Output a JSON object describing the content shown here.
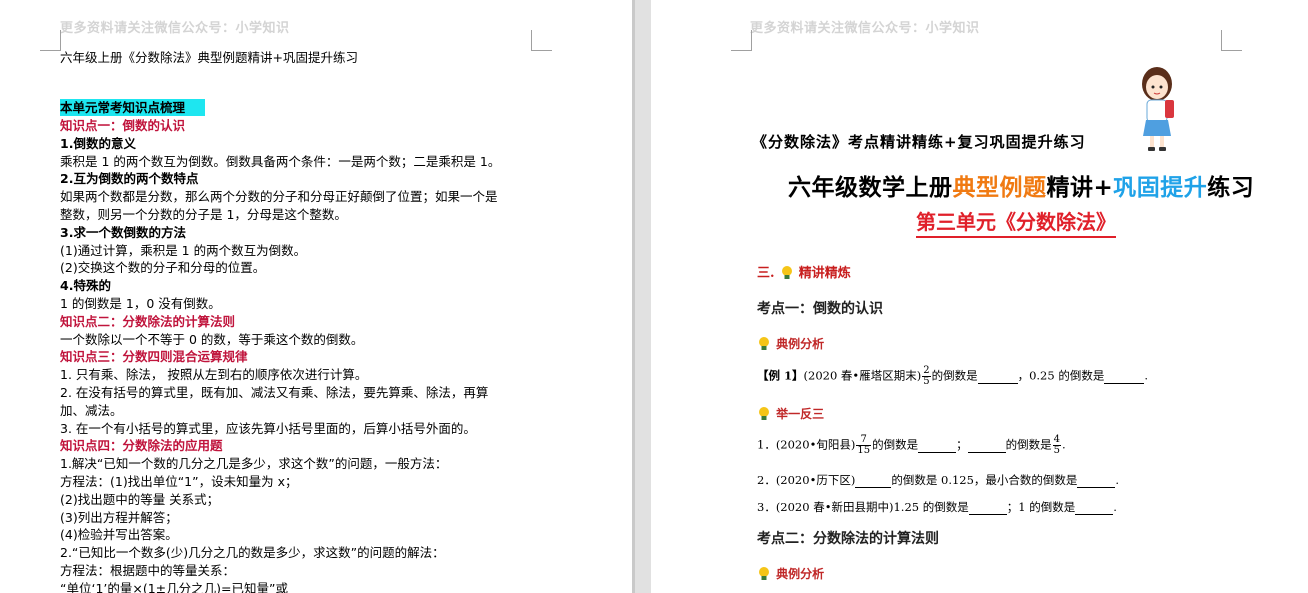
{
  "header": {
    "watermark": "更多资料请关注微信公众号：小学知识"
  },
  "left_page": {
    "doc_title": "六年级上册《分数除法》典型例题精讲+巩固提升练习",
    "section_title": "本单元常考知识点梳理",
    "lines": [
      {
        "text": "知识点一：倒数的认识",
        "style": "red"
      },
      {
        "text": "1.倒数的意义",
        "style": "bold"
      },
      {
        "text": "乘积是 1 的两个数互为倒数。倒数具备两个条件：一是两个数；二是乘积是 1。",
        "style": "normal"
      },
      {
        "text": "2.互为倒数的两个数特点",
        "style": "bold"
      },
      {
        "text": "如果两个数都是分数，那么两个分数的分子和分母正好颠倒了位置；如果一个是",
        "style": "normal"
      },
      {
        "text": "整数，则另一个分数的分子是 1，分母是这个整数。",
        "style": "normal"
      },
      {
        "text": "3.求一个数倒数的方法",
        "style": "bold"
      },
      {
        "text": "(1)通过计算，乘积是 1 的两个数互为倒数。",
        "style": "normal"
      },
      {
        "text": "(2)交换这个数的分子和分母的位置。",
        "style": "normal"
      },
      {
        "text": "4.特殊的",
        "style": "bold"
      },
      {
        "text": "1 的倒数是 1，0 没有倒数。",
        "style": "normal"
      },
      {
        "text": "知识点二：分数除法的计算法则",
        "style": "red"
      },
      {
        "text": "一个数除以一个不等于 0 的数，等于乘这个数的倒数。",
        "style": "normal"
      },
      {
        "text": "知识点三：分数四则混合运算规律",
        "style": "red"
      },
      {
        "text": "1. 只有乘、除法， 按照从左到右的顺序依次进行计算。",
        "style": "normal"
      },
      {
        "text": "2. 在没有括号的算式里，既有加、减法又有乘、除法，要先算乘、除法，再算",
        "style": "normal"
      },
      {
        "text": "加、减法。",
        "style": "normal"
      },
      {
        "text": "3. 在一个有小括号的算式里，应该先算小括号里面的，后算小括号外面的。",
        "style": "normal"
      },
      {
        "text": "知识点四：分数除法的应用题",
        "style": "red"
      },
      {
        "text": "1.解决“已知一个数的几分之几是多少，求这个数”的问题，一般方法：",
        "style": "normal"
      },
      {
        "text": "方程法：(1)找出单位“1”，设未知量为 x；",
        "style": "normal"
      },
      {
        "text": "(2)找出题中的等量 关系式；",
        "style": "normal"
      },
      {
        "text": "(3)列出方程并解答；",
        "style": "normal"
      },
      {
        "text": "(4)检验并写出答案。",
        "style": "normal"
      },
      {
        "text": "2.“已知比一个数多(少)几分之几的数是多少，求这数”的问题的解法：",
        "style": "normal"
      },
      {
        "text": "方程法：根据题中的等量关系：",
        "style": "normal"
      },
      {
        "text": "“单位‘1’的量×(1±几分之几)=已知量”或",
        "style": "normal"
      }
    ]
  },
  "right_page": {
    "subtitle": "《分数除法》考点精讲精练+复习巩固提升练习",
    "title_part1": "六年级数学上册",
    "title_part2": "典型例题",
    "title_part3": "精讲+",
    "title_part4": "巩固提升",
    "title_part5": "练习",
    "unit_title": "第三单元《分数除法》",
    "section_label": "三.",
    "section_head": "精讲精炼",
    "kp1": "考点一：倒数的认识",
    "example_head": "典例分析",
    "example": {
      "prefix": "【例 1】",
      "source": "(2020 春•雁塔区期末)",
      "frac_num": "2",
      "frac_den": "5",
      "text1": "的倒数是",
      "text2": "，0.25 的倒数是",
      "end": "."
    },
    "practice_head": "举一反三",
    "q1": {
      "pre": "1．(2020•旬阳县)",
      "frac1_num": "7",
      "frac1_den": "15",
      "t1": "的倒数是",
      "t2": "；",
      "t3": "的倒数是",
      "frac2_num": "4",
      "frac2_den": "5",
      "end": "."
    },
    "q2": {
      "pre": "2．(2020•历下区)",
      "t1": "的倒数是 0.125，最小合数的倒数是",
      "end": "."
    },
    "q3": {
      "pre": "3．(2020 春•新田县期中)1.25 的倒数是",
      "t1": "；1 的倒数是",
      "end": "."
    },
    "kp2": "考点二：分数除法的计算法则",
    "example_head2": "典例分析"
  },
  "colors": {
    "red": "#c0143c",
    "highlight": "#1ee6f0",
    "orange": "#f07a12",
    "blue": "#1fa2e8"
  }
}
